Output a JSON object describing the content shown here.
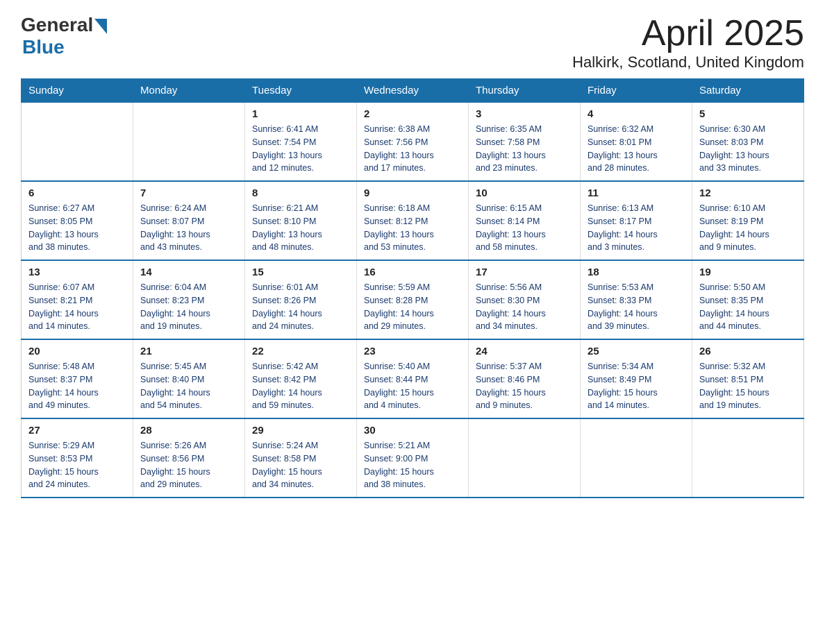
{
  "logo": {
    "text_general": "General",
    "text_blue": "Blue"
  },
  "title": "April 2025",
  "subtitle": "Halkirk, Scotland, United Kingdom",
  "days_of_week": [
    "Sunday",
    "Monday",
    "Tuesday",
    "Wednesday",
    "Thursday",
    "Friday",
    "Saturday"
  ],
  "weeks": [
    [
      {
        "day": "",
        "info": ""
      },
      {
        "day": "",
        "info": ""
      },
      {
        "day": "1",
        "info": "Sunrise: 6:41 AM\nSunset: 7:54 PM\nDaylight: 13 hours\nand 12 minutes."
      },
      {
        "day": "2",
        "info": "Sunrise: 6:38 AM\nSunset: 7:56 PM\nDaylight: 13 hours\nand 17 minutes."
      },
      {
        "day": "3",
        "info": "Sunrise: 6:35 AM\nSunset: 7:58 PM\nDaylight: 13 hours\nand 23 minutes."
      },
      {
        "day": "4",
        "info": "Sunrise: 6:32 AM\nSunset: 8:01 PM\nDaylight: 13 hours\nand 28 minutes."
      },
      {
        "day": "5",
        "info": "Sunrise: 6:30 AM\nSunset: 8:03 PM\nDaylight: 13 hours\nand 33 minutes."
      }
    ],
    [
      {
        "day": "6",
        "info": "Sunrise: 6:27 AM\nSunset: 8:05 PM\nDaylight: 13 hours\nand 38 minutes."
      },
      {
        "day": "7",
        "info": "Sunrise: 6:24 AM\nSunset: 8:07 PM\nDaylight: 13 hours\nand 43 minutes."
      },
      {
        "day": "8",
        "info": "Sunrise: 6:21 AM\nSunset: 8:10 PM\nDaylight: 13 hours\nand 48 minutes."
      },
      {
        "day": "9",
        "info": "Sunrise: 6:18 AM\nSunset: 8:12 PM\nDaylight: 13 hours\nand 53 minutes."
      },
      {
        "day": "10",
        "info": "Sunrise: 6:15 AM\nSunset: 8:14 PM\nDaylight: 13 hours\nand 58 minutes."
      },
      {
        "day": "11",
        "info": "Sunrise: 6:13 AM\nSunset: 8:17 PM\nDaylight: 14 hours\nand 3 minutes."
      },
      {
        "day": "12",
        "info": "Sunrise: 6:10 AM\nSunset: 8:19 PM\nDaylight: 14 hours\nand 9 minutes."
      }
    ],
    [
      {
        "day": "13",
        "info": "Sunrise: 6:07 AM\nSunset: 8:21 PM\nDaylight: 14 hours\nand 14 minutes."
      },
      {
        "day": "14",
        "info": "Sunrise: 6:04 AM\nSunset: 8:23 PM\nDaylight: 14 hours\nand 19 minutes."
      },
      {
        "day": "15",
        "info": "Sunrise: 6:01 AM\nSunset: 8:26 PM\nDaylight: 14 hours\nand 24 minutes."
      },
      {
        "day": "16",
        "info": "Sunrise: 5:59 AM\nSunset: 8:28 PM\nDaylight: 14 hours\nand 29 minutes."
      },
      {
        "day": "17",
        "info": "Sunrise: 5:56 AM\nSunset: 8:30 PM\nDaylight: 14 hours\nand 34 minutes."
      },
      {
        "day": "18",
        "info": "Sunrise: 5:53 AM\nSunset: 8:33 PM\nDaylight: 14 hours\nand 39 minutes."
      },
      {
        "day": "19",
        "info": "Sunrise: 5:50 AM\nSunset: 8:35 PM\nDaylight: 14 hours\nand 44 minutes."
      }
    ],
    [
      {
        "day": "20",
        "info": "Sunrise: 5:48 AM\nSunset: 8:37 PM\nDaylight: 14 hours\nand 49 minutes."
      },
      {
        "day": "21",
        "info": "Sunrise: 5:45 AM\nSunset: 8:40 PM\nDaylight: 14 hours\nand 54 minutes."
      },
      {
        "day": "22",
        "info": "Sunrise: 5:42 AM\nSunset: 8:42 PM\nDaylight: 14 hours\nand 59 minutes."
      },
      {
        "day": "23",
        "info": "Sunrise: 5:40 AM\nSunset: 8:44 PM\nDaylight: 15 hours\nand 4 minutes."
      },
      {
        "day": "24",
        "info": "Sunrise: 5:37 AM\nSunset: 8:46 PM\nDaylight: 15 hours\nand 9 minutes."
      },
      {
        "day": "25",
        "info": "Sunrise: 5:34 AM\nSunset: 8:49 PM\nDaylight: 15 hours\nand 14 minutes."
      },
      {
        "day": "26",
        "info": "Sunrise: 5:32 AM\nSunset: 8:51 PM\nDaylight: 15 hours\nand 19 minutes."
      }
    ],
    [
      {
        "day": "27",
        "info": "Sunrise: 5:29 AM\nSunset: 8:53 PM\nDaylight: 15 hours\nand 24 minutes."
      },
      {
        "day": "28",
        "info": "Sunrise: 5:26 AM\nSunset: 8:56 PM\nDaylight: 15 hours\nand 29 minutes."
      },
      {
        "day": "29",
        "info": "Sunrise: 5:24 AM\nSunset: 8:58 PM\nDaylight: 15 hours\nand 34 minutes."
      },
      {
        "day": "30",
        "info": "Sunrise: 5:21 AM\nSunset: 9:00 PM\nDaylight: 15 hours\nand 38 minutes."
      },
      {
        "day": "",
        "info": ""
      },
      {
        "day": "",
        "info": ""
      },
      {
        "day": "",
        "info": ""
      }
    ]
  ]
}
